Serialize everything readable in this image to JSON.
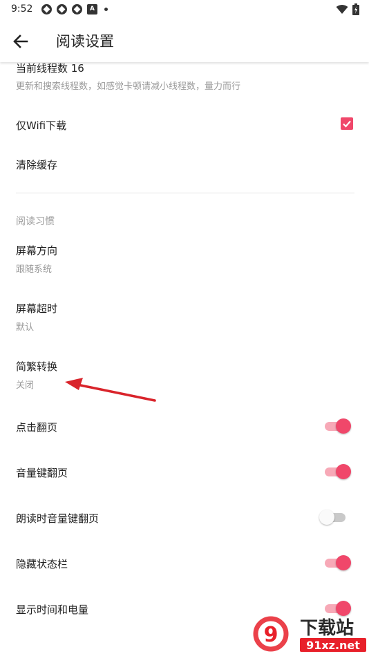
{
  "status_bar": {
    "time": "9:52"
  },
  "app_bar": {
    "title": "阅读设置"
  },
  "settings": {
    "threads": {
      "title": "当前线程数 16",
      "summary": "更新和搜索线程数，如感觉卡顿请减小线程数，量力而行"
    },
    "wifi_download": {
      "title": "仅Wifi下载",
      "checked": true
    },
    "clear_cache": {
      "title": "清除缓存"
    },
    "reading_habits_header": "阅读习惯",
    "screen_orientation": {
      "title": "屏幕方向",
      "summary": "跟随系统"
    },
    "screen_timeout": {
      "title": "屏幕超时",
      "summary": "默认"
    },
    "chinese_conversion": {
      "title": "简繁转换",
      "summary": "关闭"
    },
    "tap_page_turn": {
      "title": "点击翻页",
      "enabled": true
    },
    "volume_key_page_turn": {
      "title": "音量键翻页",
      "enabled": true
    },
    "read_aloud_volume_key": {
      "title": "朗读时音量键翻页",
      "enabled": false
    },
    "hide_status_bar": {
      "title": "隐藏状态栏",
      "enabled": true
    },
    "show_time_battery": {
      "title": "显示时间和电量",
      "enabled": true
    }
  },
  "watermark": {
    "text": "下载站",
    "url_text": "91xz.net"
  },
  "colors": {
    "accent": "#f0476a",
    "accent_light": "#f7a9b7",
    "arrow": "#d9242b"
  }
}
